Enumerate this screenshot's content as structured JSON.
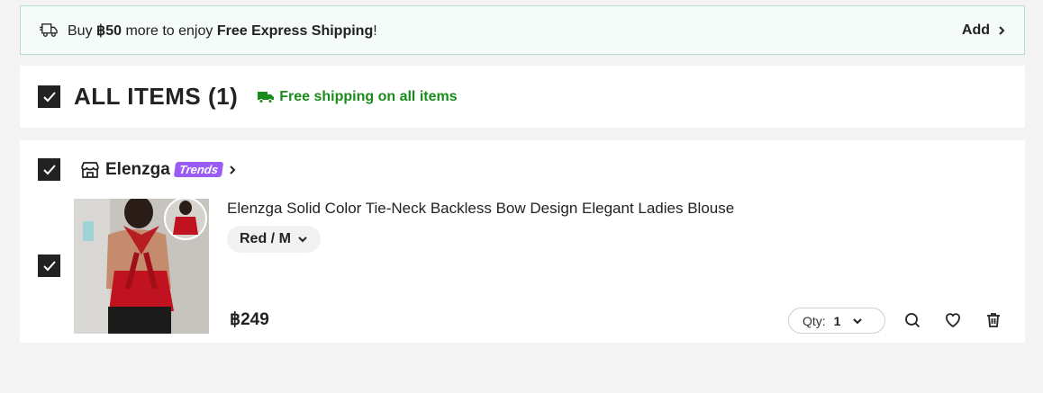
{
  "shipping_banner": {
    "text_prefix": "Buy ",
    "amount": "฿50",
    "text_middle": " more to enjoy ",
    "highlight": "Free Express Shipping",
    "text_suffix": "!",
    "add_label": "Add"
  },
  "header": {
    "title": "ALL ITEMS (1)",
    "free_shipping": "Free shipping on all items"
  },
  "store": {
    "name": "Elenzga",
    "badge": "Trends"
  },
  "item": {
    "title": "Elenzga Solid Color Tie-Neck Backless Bow Design Elegant Ladies Blouse",
    "variant": "Red / M",
    "price": "฿249",
    "qty_label": "Qty:",
    "qty_value": "1"
  },
  "colors": {
    "accent_green": "#198b1b",
    "badge_purple": "#9b5cf6",
    "checkbox": "#222222"
  },
  "icons": [
    "truck-icon",
    "chevron-right-icon",
    "checkbox-icon",
    "store-icon",
    "chevron-down-icon",
    "search-icon",
    "heart-icon",
    "trash-icon"
  ]
}
